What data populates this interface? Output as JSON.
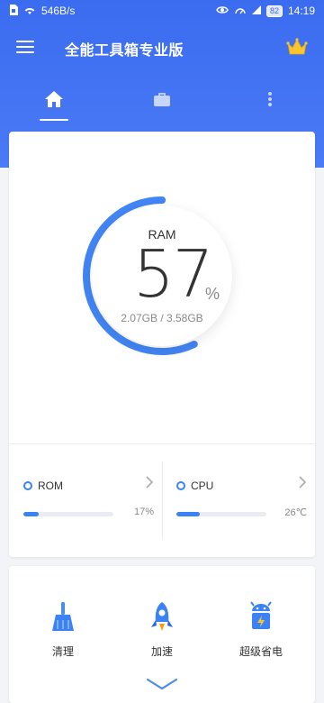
{
  "status_bar": {
    "speed": "546B/s",
    "battery": "82",
    "time": "14:19"
  },
  "app_bar": {
    "title": "全能工具箱专业版"
  },
  "tabs": [
    {
      "name": "home-tab",
      "icon": "home-icon"
    },
    {
      "name": "toolbox-tab",
      "icon": "briefcase-icon"
    },
    {
      "name": "more-tab",
      "icon": "more-vertical-icon"
    }
  ],
  "ram": {
    "label": "RAM",
    "value": "57",
    "unit": "%",
    "detail": "2.07GB / 3.58GB",
    "progress": 0.57
  },
  "metrics": {
    "rom": {
      "label": "ROM",
      "percent_text": "17%",
      "progress": 0.17
    },
    "cpu": {
      "label": "CPU",
      "percent_text": "26℃",
      "progress": 0.26
    }
  },
  "tools": [
    {
      "label": "清理",
      "icon": "broom-icon"
    },
    {
      "label": "加速",
      "icon": "rocket-icon"
    },
    {
      "label": "超级省电",
      "icon": "android-battery-icon"
    }
  ],
  "colors": {
    "primary": "#3b6cf0",
    "accent": "#3b82f6"
  }
}
